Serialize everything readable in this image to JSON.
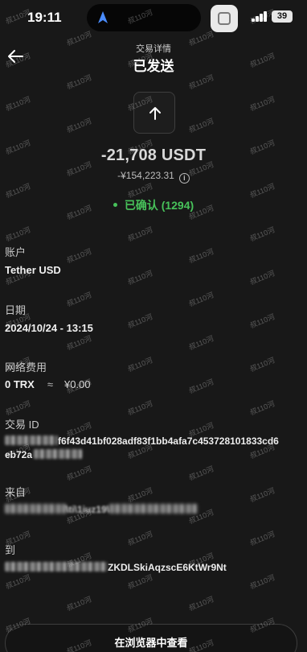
{
  "status_bar": {
    "time": "19:11",
    "battery": "39"
  },
  "header": {
    "subtitle": "交易详情",
    "title": "已发送"
  },
  "hero": {
    "amount": "-21,708 USDT",
    "fiat_value": "-¥154,223.31",
    "status": "已确认 (1294)",
    "status_color": "#47c15a"
  },
  "account": {
    "label": "账户",
    "value": "Tether USD"
  },
  "date": {
    "label": "日期",
    "value": "2024/10/24 - 13:15"
  },
  "network_fee": {
    "label": "网络费用",
    "amount": "0 TRX",
    "approx": "≈",
    "fiat": "¥0.00"
  },
  "tx_id": {
    "label": "交易 ID",
    "value_visible_part1": "f6f43d41bf028adf83f1bb4afa7c453728101833cd6",
    "value_visible_part2": "eb72a"
  },
  "from": {
    "label": "来自",
    "value_visible": "\\ti\\1iuz19\\"
  },
  "to": {
    "label": "到",
    "value_visible": "ZKDLSkiAqzscE6KtWr9Nt"
  },
  "actions": {
    "view_in_browser": "在浏览器中查看"
  },
  "watermark": {
    "text": "叔110河"
  },
  "icons": {
    "back": "back-arrow-icon",
    "transaction": "arrow-up-icon",
    "info": "info-icon",
    "navigation": "navigation-arrow-icon"
  }
}
